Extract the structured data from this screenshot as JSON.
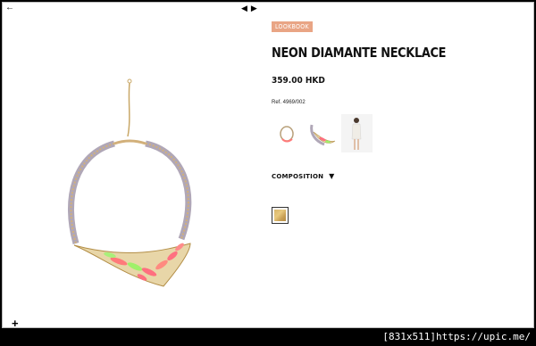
{
  "product": {
    "badge": "LOOKBOOK",
    "title": "NEON DIAMANTE NECKLACE",
    "price": "359.00 HKD",
    "reference": "Ref. 4969/002",
    "composition_label": "COMPOSITION"
  },
  "icons": {
    "corner_arrow": "←",
    "prev": "◀",
    "next": "▶",
    "corner_plus": "+",
    "composition_toggle": "▼"
  },
  "watermark": "[831x511]https://upic.me/"
}
